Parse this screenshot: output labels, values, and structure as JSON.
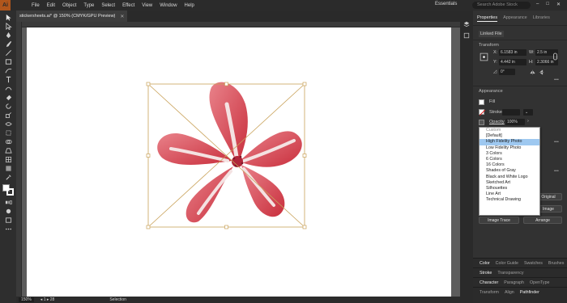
{
  "app": {
    "logo_text": "Ai",
    "menus": [
      "File",
      "Edit",
      "Object",
      "Type",
      "Select",
      "Effect",
      "View",
      "Window",
      "Help"
    ],
    "workspace": "Essentials",
    "search_placeholder": "Search Adobe Stock",
    "window_controls": [
      "–",
      "□",
      "✕"
    ]
  },
  "document": {
    "tab_title": "stickersheets.ai* @ 150% (CMYK/GPU Preview)",
    "close_label": "✕"
  },
  "status": {
    "zoom": "150%",
    "artboard": "1",
    "artboard_total": "28",
    "tool_name": "Selection"
  },
  "panel": {
    "tabs": [
      "Properties",
      "Appearance",
      "Libraries"
    ],
    "active_tab": "Properties",
    "linked_file": "Linked File",
    "transform_title": "Transform",
    "x_label": "X:",
    "x_value": "6.1583 in",
    "y_label": "Y:",
    "y_value": "4.442 in",
    "w_label": "W:",
    "w_value": "2.5 in",
    "h_label": "H:",
    "h_value": "2.3066 in",
    "angle_value": "0°",
    "appearance_title": "Appearance",
    "fill_label": "Fill",
    "stroke_label": "Stroke",
    "opacity_label": "Opacity",
    "opacity_value": "100%",
    "original_btn": "Original",
    "image_btn": "Image",
    "image_trace_btn": "Image Trace",
    "arrange_btn": "Arrange",
    "more_glyph": "•••"
  },
  "dropdown": {
    "items": [
      "Custom",
      "[Default]",
      "High Fidelity Photo",
      "Low Fidelity Photo",
      "3 Colors",
      "6 Colors",
      "16 Colors",
      "Shades of Gray",
      "Black and White Logo",
      "Sketched Art",
      "Silhouettes",
      "Line Art",
      "Technical Drawing"
    ],
    "selected": "High Fidelity Photo"
  },
  "bottom_panels": [
    {
      "tabs": [
        "Color",
        "Color Guide",
        "Swatches",
        "Brushes"
      ],
      "active": "Color"
    },
    {
      "tabs": [
        "Stroke",
        "Transparency"
      ],
      "active": "Stroke"
    },
    {
      "tabs": [
        "Character",
        "Paragraph",
        "OpenType"
      ],
      "active": "Character"
    },
    {
      "tabs": [
        "Transform",
        "Align",
        "Pathfinder"
      ],
      "active": "Pathfinder"
    }
  ],
  "colors": {
    "accent": "#9ec8f0",
    "bounding_box": "#c9a25a",
    "petal": "#d9454f",
    "app_logo": "#b0561c"
  },
  "tools": [
    "selection-tool-icon",
    "direct-selection-tool-icon",
    "magic-wand-icon",
    "lasso-icon",
    "pen-icon",
    "curvature-icon",
    "type-icon",
    "line-icon",
    "rectangle-icon",
    "paintbrush-icon",
    "shaper-icon",
    "eraser-icon",
    "rotate-icon",
    "scale-icon",
    "width-icon",
    "free-transform-icon",
    "shape-builder-icon",
    "perspective-icon",
    "mesh-icon",
    "gradient-icon",
    "eyedropper-icon",
    "blend-icon",
    "symbol-sprayer-icon",
    "graph-icon",
    "artboard-icon",
    "slice-icon",
    "hand-icon",
    "zoom-icon",
    "fill-stroke-icon",
    "screen-mode-icon",
    "edit-toolbar-icon"
  ]
}
